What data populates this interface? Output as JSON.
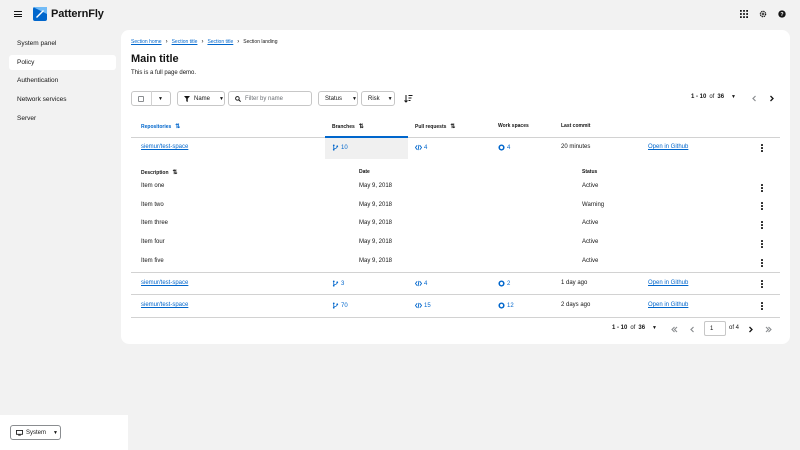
{
  "brand": {
    "name": "PatternFly"
  },
  "sidebar": {
    "items": [
      {
        "label": "System panel",
        "active": false
      },
      {
        "label": "Policy",
        "active": true
      },
      {
        "label": "Authentication",
        "active": false
      },
      {
        "label": "Network services",
        "active": false
      },
      {
        "label": "Server",
        "active": false
      }
    ],
    "system_label": "System"
  },
  "breadcrumb": [
    "Section home",
    "Section title",
    "Section title",
    "Section landing"
  ],
  "main": {
    "title": "Main title",
    "description": "This is a full page demo."
  },
  "toolbar": {
    "filter_attribute": "Name",
    "search_placeholder": "Filter by name",
    "status_label": "Status",
    "risk_label": "Risk"
  },
  "pagination": {
    "range": "1 - 10",
    "of_word": "of",
    "total": "36",
    "current_page": "1",
    "page_count_label": "of 4"
  },
  "table": {
    "columns": [
      "Repositories",
      "Branches",
      "Pull requests",
      "Work spaces",
      "Last commit"
    ],
    "rows": [
      {
        "repo": "siemur/test-space",
        "branches": "10",
        "prs": "4",
        "workspaces": "4",
        "last_commit": "20 minutes",
        "action": "Open in Github"
      },
      {
        "repo": "siemur/test-space",
        "branches": "3",
        "prs": "4",
        "workspaces": "2",
        "last_commit": "1 day ago",
        "action": "Open in Github"
      },
      {
        "repo": "siemur/test-space",
        "branches": "70",
        "prs": "15",
        "workspaces": "12",
        "last_commit": "2 days ago",
        "action": "Open in Github"
      }
    ],
    "nested": {
      "columns": [
        "Description",
        "Date",
        "Status"
      ],
      "rows": [
        {
          "description": "Item one",
          "date": "May 9, 2018",
          "status": "Active"
        },
        {
          "description": "Item two",
          "date": "May 9, 2018",
          "status": "Warning"
        },
        {
          "description": "Item three",
          "date": "May 9, 2018",
          "status": "Active"
        },
        {
          "description": "Item four",
          "date": "May 9, 2018",
          "status": "Active"
        },
        {
          "description": "Item five",
          "date": "May 9, 2018",
          "status": "Active"
        }
      ]
    }
  },
  "icons": {
    "menu": "hamburger-icon",
    "apps": "grid-icon",
    "settings": "gear-icon",
    "help": "question-circle-icon",
    "branch": "code-branch-icon",
    "pr": "code-icon",
    "workspace": "cube-icon",
    "sort": "sort-amount-icon"
  },
  "colors": {
    "link": "#0066cc",
    "page_bg": "#f2f2f2",
    "panel_bg": "#ffffff",
    "border": "#d2d2d2"
  }
}
